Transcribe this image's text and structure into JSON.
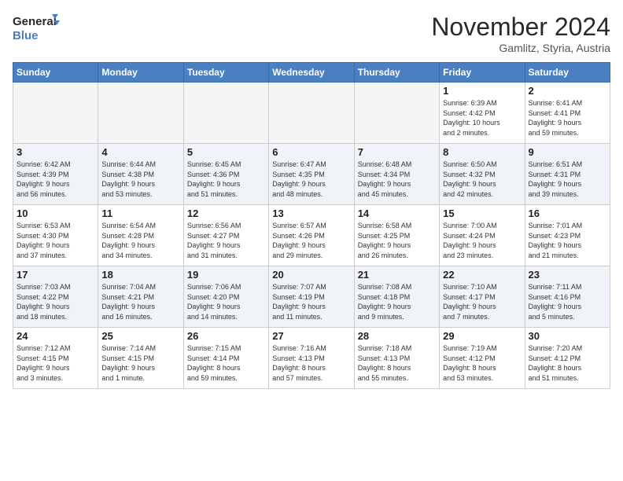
{
  "logo": {
    "line1": "General",
    "line2": "Blue"
  },
  "title": "November 2024",
  "location": "Gamlitz, Styria, Austria",
  "weekdays": [
    "Sunday",
    "Monday",
    "Tuesday",
    "Wednesday",
    "Thursday",
    "Friday",
    "Saturday"
  ],
  "weeks": [
    [
      {
        "day": "",
        "info": ""
      },
      {
        "day": "",
        "info": ""
      },
      {
        "day": "",
        "info": ""
      },
      {
        "day": "",
        "info": ""
      },
      {
        "day": "",
        "info": ""
      },
      {
        "day": "1",
        "info": "Sunrise: 6:39 AM\nSunset: 4:42 PM\nDaylight: 10 hours\nand 2 minutes."
      },
      {
        "day": "2",
        "info": "Sunrise: 6:41 AM\nSunset: 4:41 PM\nDaylight: 9 hours\nand 59 minutes."
      }
    ],
    [
      {
        "day": "3",
        "info": "Sunrise: 6:42 AM\nSunset: 4:39 PM\nDaylight: 9 hours\nand 56 minutes."
      },
      {
        "day": "4",
        "info": "Sunrise: 6:44 AM\nSunset: 4:38 PM\nDaylight: 9 hours\nand 53 minutes."
      },
      {
        "day": "5",
        "info": "Sunrise: 6:45 AM\nSunset: 4:36 PM\nDaylight: 9 hours\nand 51 minutes."
      },
      {
        "day": "6",
        "info": "Sunrise: 6:47 AM\nSunset: 4:35 PM\nDaylight: 9 hours\nand 48 minutes."
      },
      {
        "day": "7",
        "info": "Sunrise: 6:48 AM\nSunset: 4:34 PM\nDaylight: 9 hours\nand 45 minutes."
      },
      {
        "day": "8",
        "info": "Sunrise: 6:50 AM\nSunset: 4:32 PM\nDaylight: 9 hours\nand 42 minutes."
      },
      {
        "day": "9",
        "info": "Sunrise: 6:51 AM\nSunset: 4:31 PM\nDaylight: 9 hours\nand 39 minutes."
      }
    ],
    [
      {
        "day": "10",
        "info": "Sunrise: 6:53 AM\nSunset: 4:30 PM\nDaylight: 9 hours\nand 37 minutes."
      },
      {
        "day": "11",
        "info": "Sunrise: 6:54 AM\nSunset: 4:28 PM\nDaylight: 9 hours\nand 34 minutes."
      },
      {
        "day": "12",
        "info": "Sunrise: 6:56 AM\nSunset: 4:27 PM\nDaylight: 9 hours\nand 31 minutes."
      },
      {
        "day": "13",
        "info": "Sunrise: 6:57 AM\nSunset: 4:26 PM\nDaylight: 9 hours\nand 29 minutes."
      },
      {
        "day": "14",
        "info": "Sunrise: 6:58 AM\nSunset: 4:25 PM\nDaylight: 9 hours\nand 26 minutes."
      },
      {
        "day": "15",
        "info": "Sunrise: 7:00 AM\nSunset: 4:24 PM\nDaylight: 9 hours\nand 23 minutes."
      },
      {
        "day": "16",
        "info": "Sunrise: 7:01 AM\nSunset: 4:23 PM\nDaylight: 9 hours\nand 21 minutes."
      }
    ],
    [
      {
        "day": "17",
        "info": "Sunrise: 7:03 AM\nSunset: 4:22 PM\nDaylight: 9 hours\nand 18 minutes."
      },
      {
        "day": "18",
        "info": "Sunrise: 7:04 AM\nSunset: 4:21 PM\nDaylight: 9 hours\nand 16 minutes."
      },
      {
        "day": "19",
        "info": "Sunrise: 7:06 AM\nSunset: 4:20 PM\nDaylight: 9 hours\nand 14 minutes."
      },
      {
        "day": "20",
        "info": "Sunrise: 7:07 AM\nSunset: 4:19 PM\nDaylight: 9 hours\nand 11 minutes."
      },
      {
        "day": "21",
        "info": "Sunrise: 7:08 AM\nSunset: 4:18 PM\nDaylight: 9 hours\nand 9 minutes."
      },
      {
        "day": "22",
        "info": "Sunrise: 7:10 AM\nSunset: 4:17 PM\nDaylight: 9 hours\nand 7 minutes."
      },
      {
        "day": "23",
        "info": "Sunrise: 7:11 AM\nSunset: 4:16 PM\nDaylight: 9 hours\nand 5 minutes."
      }
    ],
    [
      {
        "day": "24",
        "info": "Sunrise: 7:12 AM\nSunset: 4:15 PM\nDaylight: 9 hours\nand 3 minutes."
      },
      {
        "day": "25",
        "info": "Sunrise: 7:14 AM\nSunset: 4:15 PM\nDaylight: 9 hours\nand 1 minute."
      },
      {
        "day": "26",
        "info": "Sunrise: 7:15 AM\nSunset: 4:14 PM\nDaylight: 8 hours\nand 59 minutes."
      },
      {
        "day": "27",
        "info": "Sunrise: 7:16 AM\nSunset: 4:13 PM\nDaylight: 8 hours\nand 57 minutes."
      },
      {
        "day": "28",
        "info": "Sunrise: 7:18 AM\nSunset: 4:13 PM\nDaylight: 8 hours\nand 55 minutes."
      },
      {
        "day": "29",
        "info": "Sunrise: 7:19 AM\nSunset: 4:12 PM\nDaylight: 8 hours\nand 53 minutes."
      },
      {
        "day": "30",
        "info": "Sunrise: 7:20 AM\nSunset: 4:12 PM\nDaylight: 8 hours\nand 51 minutes."
      }
    ]
  ]
}
